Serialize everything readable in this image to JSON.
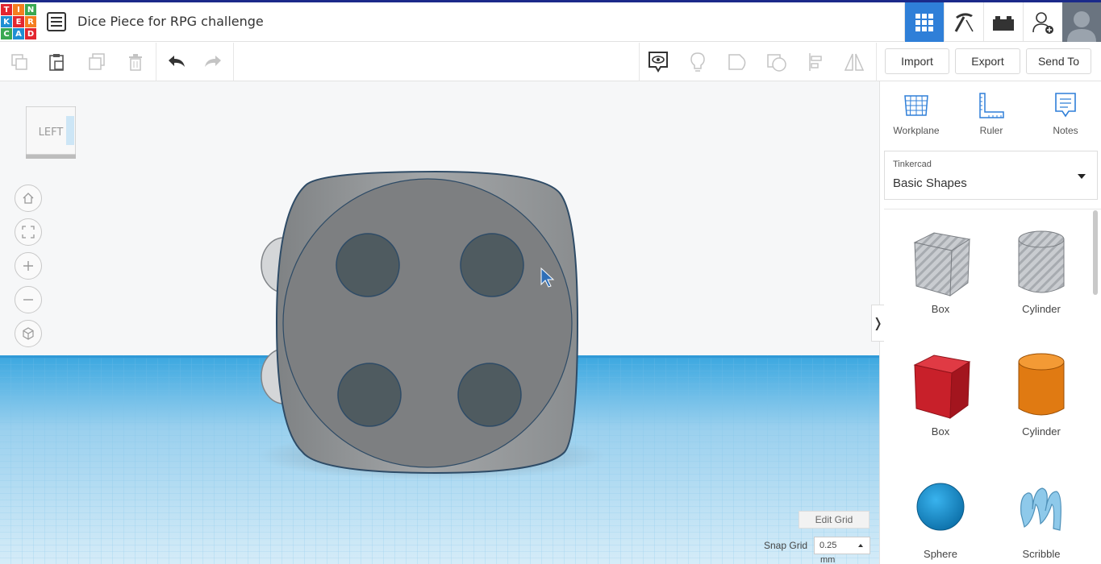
{
  "app": {
    "logo_letters": [
      "T",
      "I",
      "N",
      "K",
      "E",
      "R",
      "C",
      "A",
      "D"
    ],
    "logo_colors": [
      "#e3262f",
      "#f57e20",
      "#39a852",
      "#1f8fd3",
      "#e3262f",
      "#f57e20",
      "#39a852",
      "#1f8fd3",
      "#e3262f"
    ],
    "design_title": "Dice Piece for RPG challenge"
  },
  "header": {
    "icons": [
      "grid-view-icon",
      "pickaxe-icon",
      "bricks-icon",
      "add-user-icon",
      "profile-avatar"
    ],
    "active_tab": "grid-view-icon",
    "accent_color": "#2f7fd8"
  },
  "toolbar": {
    "left_icons": [
      "copy-icon",
      "paste-icon",
      "duplicate-icon",
      "delete-icon",
      "undo-icon",
      "redo-icon"
    ],
    "right_icons": [
      "show-hide-icon",
      "lightbulb-icon",
      "group-icon",
      "ungroup-icon",
      "align-icon",
      "mirror-icon"
    ],
    "import_label": "Import",
    "export_label": "Export",
    "send_to_label": "Send To"
  },
  "viewport": {
    "view_cube_label": "LEFT",
    "nav_controls": [
      "home-view-icon",
      "fit-view-icon",
      "zoom-in-icon",
      "zoom-out-icon",
      "perspective-icon"
    ],
    "edit_grid_label": "Edit Grid",
    "snap_grid_label": "Snap Grid",
    "snap_grid_value": "0.25",
    "snap_grid_unit": "mm",
    "die_face_pips": 4,
    "die_color": "#8a8d8f",
    "grid_color": "#5bb8e8"
  },
  "panel": {
    "collapse_glyph": "❭",
    "tools": [
      {
        "label": "Workplane",
        "icon": "workplane-icon"
      },
      {
        "label": "Ruler",
        "icon": "ruler-icon"
      },
      {
        "label": "Notes",
        "icon": "notes-icon"
      }
    ],
    "library_category": "Tinkercad",
    "library_name": "Basic Shapes",
    "shapes": [
      {
        "label": "Box",
        "style": "hole",
        "color": "#b9bcc0"
      },
      {
        "label": "Cylinder",
        "style": "hole",
        "color": "#b9bcc0"
      },
      {
        "label": "Box",
        "style": "solid",
        "color": "#c8202a"
      },
      {
        "label": "Cylinder",
        "style": "solid",
        "color": "#e07a12"
      },
      {
        "label": "Sphere",
        "style": "solid",
        "color": "#1b8fd0"
      },
      {
        "label": "Scribble",
        "style": "solid",
        "color": "#8ec9ea"
      }
    ]
  }
}
